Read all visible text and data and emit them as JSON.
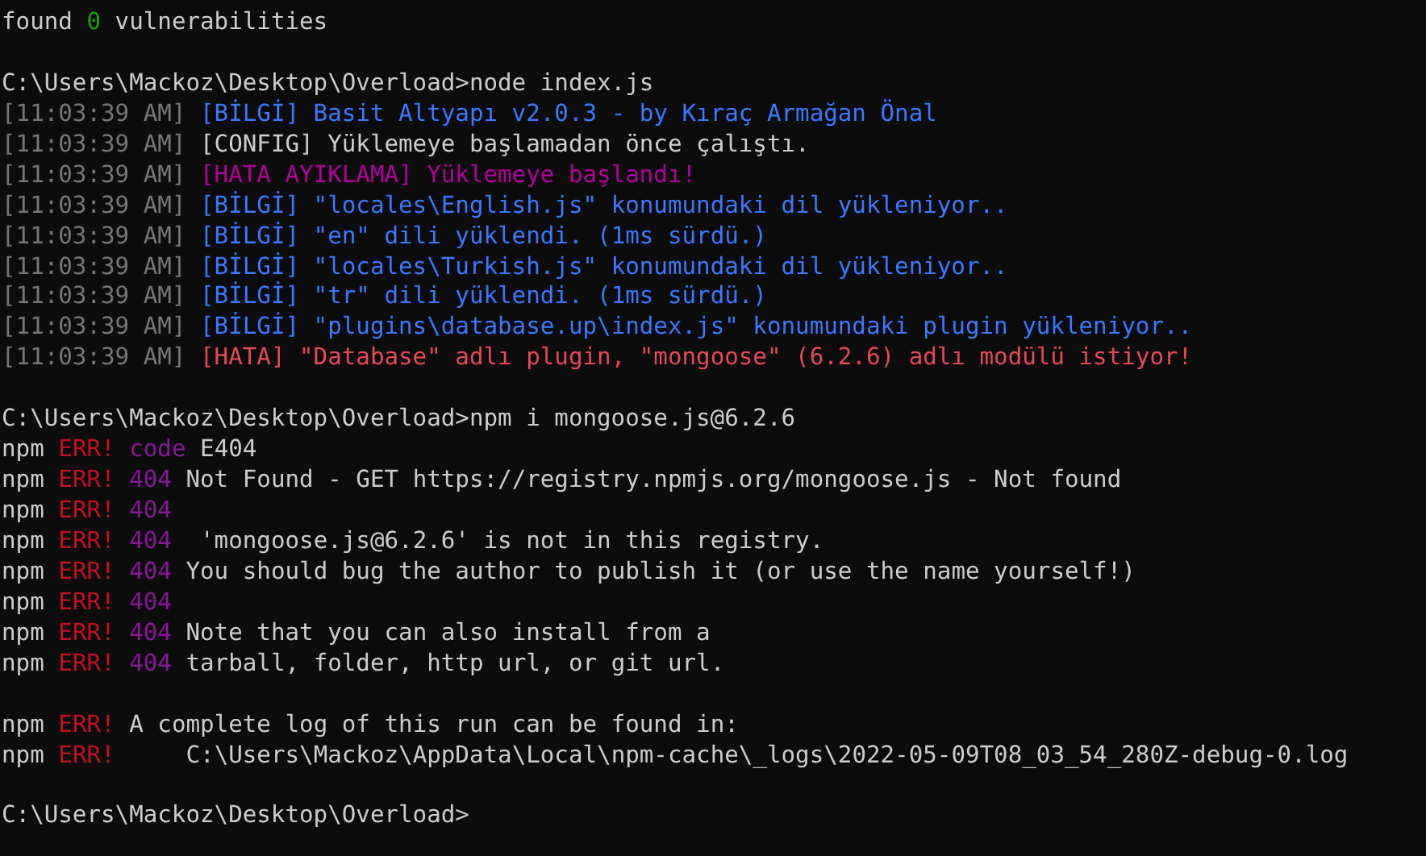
{
  "terminal": {
    "lines": [
      {
        "kind": "text",
        "segments": [
          {
            "text": "found ",
            "color": "#cccccc"
          },
          {
            "text": "0",
            "color": "#13a10e"
          },
          {
            "text": " vulnerabilities",
            "color": "#cccccc"
          }
        ]
      },
      {
        "kind": "blank"
      },
      {
        "kind": "text",
        "segments": [
          {
            "text": "C:\\Users\\Mackoz\\Desktop\\Overload>node index.js",
            "color": "#cccccc"
          }
        ]
      },
      {
        "kind": "text",
        "segments": [
          {
            "text": "[11:03:39 AM] ",
            "color": "#767676"
          },
          {
            "text": "[BİLGİ] Basit Altyapı v2.0.3 - by Kıraç Armağan Önal",
            "color": "#3b78ff"
          }
        ]
      },
      {
        "kind": "text",
        "segments": [
          {
            "text": "[11:03:39 AM] ",
            "color": "#767676"
          },
          {
            "text": "[CONFIG] Yüklemeye başlamadan önce çalıştı.",
            "color": "#cccccc"
          }
        ]
      },
      {
        "kind": "text",
        "segments": [
          {
            "text": "[11:03:39 AM] ",
            "color": "#767676"
          },
          {
            "text": "[HATA AYIKLAMA] Yüklemeye başlandı!",
            "color": "#b4009e"
          }
        ]
      },
      {
        "kind": "text",
        "segments": [
          {
            "text": "[11:03:39 AM] ",
            "color": "#767676"
          },
          {
            "text": "[BİLGİ] \"locales\\English.js\" konumundaki dil yükleniyor..",
            "color": "#3b78ff"
          }
        ]
      },
      {
        "kind": "text",
        "segments": [
          {
            "text": "[11:03:39 AM] ",
            "color": "#767676"
          },
          {
            "text": "[BİLGİ] \"en\" dili yüklendi. (1ms sürdü.)",
            "color": "#3b78ff"
          }
        ]
      },
      {
        "kind": "text",
        "segments": [
          {
            "text": "[11:03:39 AM] ",
            "color": "#767676"
          },
          {
            "text": "[BİLGİ] \"locales\\Turkish.js\" konumundaki dil yükleniyor..",
            "color": "#3b78ff"
          }
        ]
      },
      {
        "kind": "text",
        "segments": [
          {
            "text": "[11:03:39 AM] ",
            "color": "#767676"
          },
          {
            "text": "[BİLGİ] \"tr\" dili yüklendi. (1ms sürdü.)",
            "color": "#3b78ff"
          }
        ]
      },
      {
        "kind": "text",
        "segments": [
          {
            "text": "[11:03:39 AM] ",
            "color": "#767676"
          },
          {
            "text": "[BİLGİ] \"plugins\\database.up\\index.js\" konumundaki plugin yükleniyor..",
            "color": "#3b78ff"
          }
        ]
      },
      {
        "kind": "text",
        "segments": [
          {
            "text": "[11:03:39 AM] ",
            "color": "#767676"
          },
          {
            "text": "[HATA] \"Database\" adlı plugin, \"mongoose\" (6.2.6) adlı modülü istiyor!",
            "color": "#e74856"
          }
        ]
      },
      {
        "kind": "blank"
      },
      {
        "kind": "text",
        "segments": [
          {
            "text": "C:\\Users\\Mackoz\\Desktop\\Overload>npm i mongoose.js@6.2.6",
            "color": "#cccccc"
          }
        ]
      },
      {
        "kind": "text",
        "segments": [
          {
            "text": "npm ",
            "color": "#cccccc"
          },
          {
            "text": "ERR! ",
            "color": "#c50f1f"
          },
          {
            "text": "code",
            "color": "#881798"
          },
          {
            "text": " E404",
            "color": "#cccccc"
          }
        ]
      },
      {
        "kind": "text",
        "segments": [
          {
            "text": "npm ",
            "color": "#cccccc"
          },
          {
            "text": "ERR! ",
            "color": "#c50f1f"
          },
          {
            "text": "404",
            "color": "#881798"
          },
          {
            "text": " Not Found - GET https://registry.npmjs.org/mongoose.js - Not found",
            "color": "#cccccc"
          }
        ]
      },
      {
        "kind": "text",
        "segments": [
          {
            "text": "npm ",
            "color": "#cccccc"
          },
          {
            "text": "ERR! ",
            "color": "#c50f1f"
          },
          {
            "text": "404",
            "color": "#881798"
          }
        ]
      },
      {
        "kind": "text",
        "segments": [
          {
            "text": "npm ",
            "color": "#cccccc"
          },
          {
            "text": "ERR! ",
            "color": "#c50f1f"
          },
          {
            "text": "404",
            "color": "#881798"
          },
          {
            "text": "  'mongoose.js@6.2.6' is not in this registry.",
            "color": "#cccccc"
          }
        ]
      },
      {
        "kind": "text",
        "segments": [
          {
            "text": "npm ",
            "color": "#cccccc"
          },
          {
            "text": "ERR! ",
            "color": "#c50f1f"
          },
          {
            "text": "404",
            "color": "#881798"
          },
          {
            "text": " You should bug the author to publish it (or use the name yourself!)",
            "color": "#cccccc"
          }
        ]
      },
      {
        "kind": "text",
        "segments": [
          {
            "text": "npm ",
            "color": "#cccccc"
          },
          {
            "text": "ERR! ",
            "color": "#c50f1f"
          },
          {
            "text": "404",
            "color": "#881798"
          }
        ]
      },
      {
        "kind": "text",
        "segments": [
          {
            "text": "npm ",
            "color": "#cccccc"
          },
          {
            "text": "ERR! ",
            "color": "#c50f1f"
          },
          {
            "text": "404",
            "color": "#881798"
          },
          {
            "text": " Note that you can also install from a",
            "color": "#cccccc"
          }
        ]
      },
      {
        "kind": "text",
        "segments": [
          {
            "text": "npm ",
            "color": "#cccccc"
          },
          {
            "text": "ERR! ",
            "color": "#c50f1f"
          },
          {
            "text": "404",
            "color": "#881798"
          },
          {
            "text": " tarball, folder, http url, or git url.",
            "color": "#cccccc"
          }
        ]
      },
      {
        "kind": "blank"
      },
      {
        "kind": "text",
        "segments": [
          {
            "text": "npm ",
            "color": "#cccccc"
          },
          {
            "text": "ERR!",
            "color": "#c50f1f"
          },
          {
            "text": " A complete log of this run can be found in:",
            "color": "#cccccc"
          }
        ]
      },
      {
        "kind": "text",
        "segments": [
          {
            "text": "npm ",
            "color": "#cccccc"
          },
          {
            "text": "ERR!",
            "color": "#c50f1f"
          },
          {
            "text": "     C:\\Users\\Mackoz\\AppData\\Local\\npm-cache\\_logs\\2022-05-09T08_03_54_280Z-debug-0.log",
            "color": "#cccccc"
          }
        ]
      },
      {
        "kind": "blank"
      },
      {
        "kind": "text",
        "segments": [
          {
            "text": "C:\\Users\\Mackoz\\Desktop\\Overload>",
            "color": "#cccccc"
          }
        ]
      }
    ]
  }
}
